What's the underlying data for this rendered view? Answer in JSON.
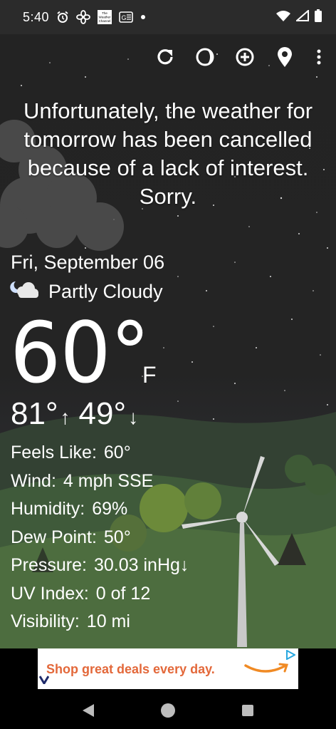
{
  "status_bar": {
    "time": "5:40",
    "icons_left": [
      "alarm-icon",
      "fan-icon",
      "weather-channel-logo",
      "news-icon",
      "dot-icon"
    ],
    "weather_channel_logo_text": [
      "The",
      "Weather",
      "Channel"
    ],
    "news_icon_text": "G",
    "icons_right": [
      "wifi-icon",
      "signal-icon",
      "battery-icon"
    ]
  },
  "toolbar": {
    "buttons": [
      "refresh-icon",
      "moon-phase-icon",
      "add-location-icon",
      "location-pin-icon",
      "more-menu-icon"
    ]
  },
  "message": "Unfortunately, the weather for tomorrow has been cancelled because of a lack of interest. Sorry.",
  "forecast": {
    "date": "Fri, September 06",
    "condition": "Partly Cloudy",
    "condition_icon": "partly-cloudy-night-icon",
    "temperature": "60°",
    "unit": "F",
    "high": "81°",
    "high_arrow": "↑",
    "low": "49°",
    "low_arrow": "↓"
  },
  "details": [
    {
      "label": "Feels Like:",
      "value": "60°"
    },
    {
      "label": "Wind:",
      "value": "4 mph SSE"
    },
    {
      "label": "Humidity:",
      "value": "69%"
    },
    {
      "label": "Dew Point:",
      "value": "50°"
    },
    {
      "label": "Pressure:",
      "value": "30.03 inHg↓"
    },
    {
      "label": "UV Index:",
      "value": "0 of 12"
    },
    {
      "label": "Visibility:",
      "value": "10 mi"
    }
  ],
  "ad": {
    "text": "Shop great deals every day.",
    "brand_colors": {
      "text": "#e3683a",
      "smile": "#f08a24",
      "adchoice": "#29a8e0"
    }
  },
  "nav": {
    "buttons": [
      "back-icon",
      "home-icon",
      "recents-icon"
    ]
  },
  "colors": {
    "status_bar": "#2b2b2b",
    "sky": "#232323",
    "grass": "#4a6a3f"
  }
}
